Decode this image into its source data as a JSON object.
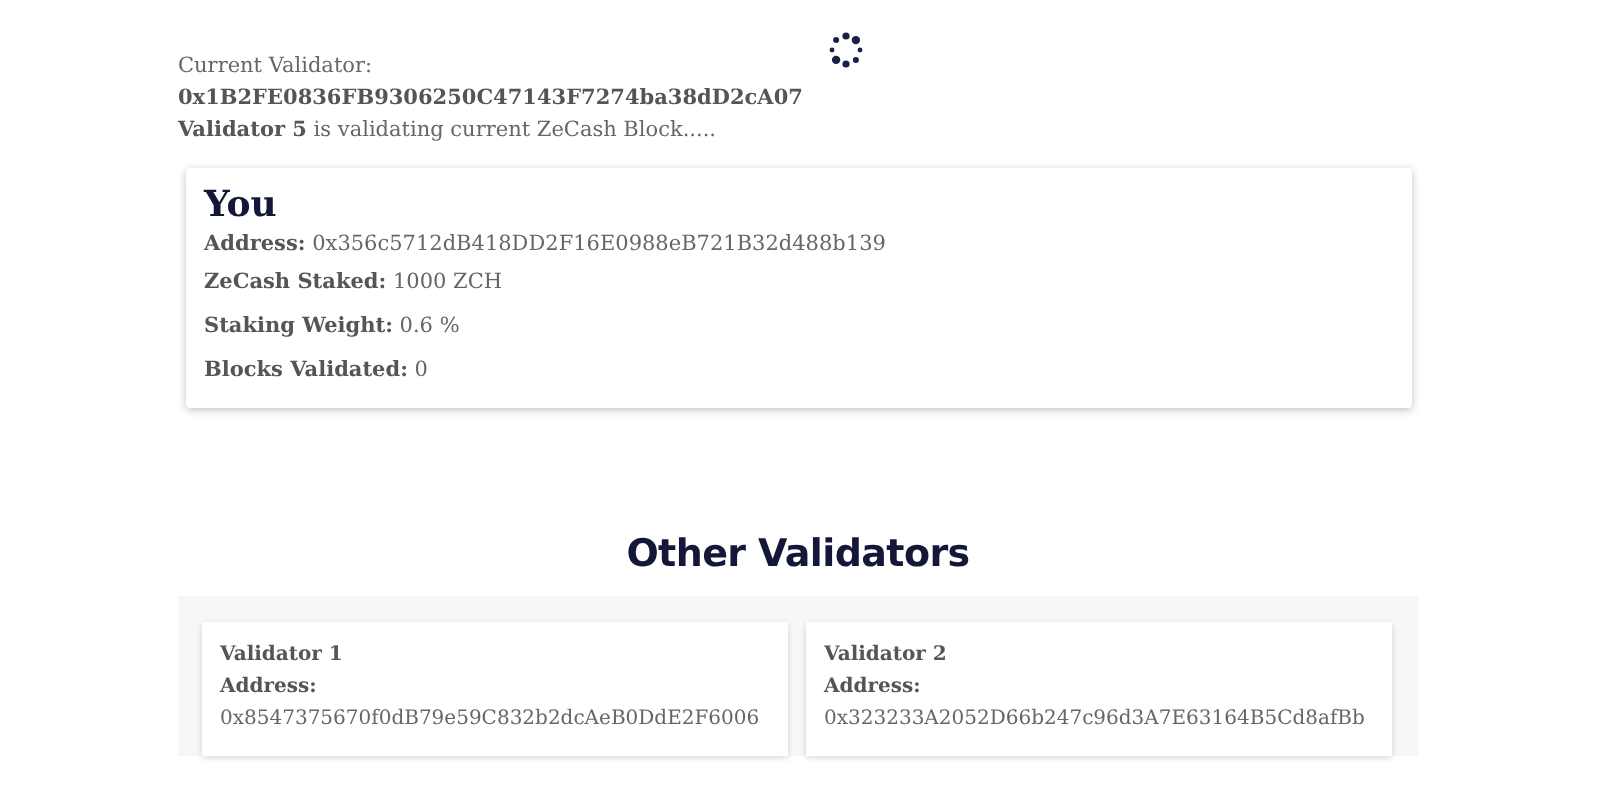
{
  "status": {
    "label": "Current Validator:",
    "address": "0x1B2FE0836FB9306250C47143F7274ba38dD2cA07",
    "message": "**Validator 5** is validating current ZeCash Block....."
  },
  "you": {
    "title": "You",
    "lines": [
      "**Address:** 0x356c5712dB418DD2F16E0988eB721B32d488b139",
      "**ZeCash Staked:** 1000 ZCH",
      "**Staking Weight:** 0.6 %",
      "**Blocks Validated:** 0"
    ]
  },
  "others": {
    "title": "Other Validators",
    "validators": [
      {
        "name": "Validator 1",
        "address_label": "Address:",
        "address": "0x8547375670f0dB79e59C832b2dcAeB0DdE2F6006"
      },
      {
        "name": "Validator 2",
        "address_label": "Address:",
        "address": "0x323233A2052D66b247c96d3A7E63164B5Cd8afBb"
      }
    ]
  }
}
